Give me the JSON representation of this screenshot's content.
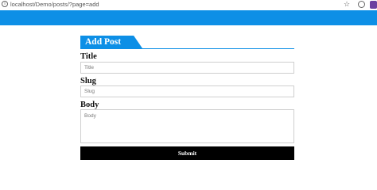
{
  "browser": {
    "url": "localhost/Demo/posts/?page=add",
    "info_icon": "info-icon",
    "star_icon": "star-icon",
    "extension_icon": "extension-icon",
    "profile_icon": "profile-icon"
  },
  "colors": {
    "accent": "#0d8fe6",
    "submit_bg": "#000000"
  },
  "form": {
    "heading": "Add Post",
    "title_label": "Title",
    "title_placeholder": "Title",
    "title_value": "",
    "slug_label": "Slug",
    "slug_placeholder": "Slug",
    "slug_value": "",
    "body_label": "Body",
    "body_placeholder": "Body",
    "body_value": "",
    "submit_label": "Submit"
  }
}
